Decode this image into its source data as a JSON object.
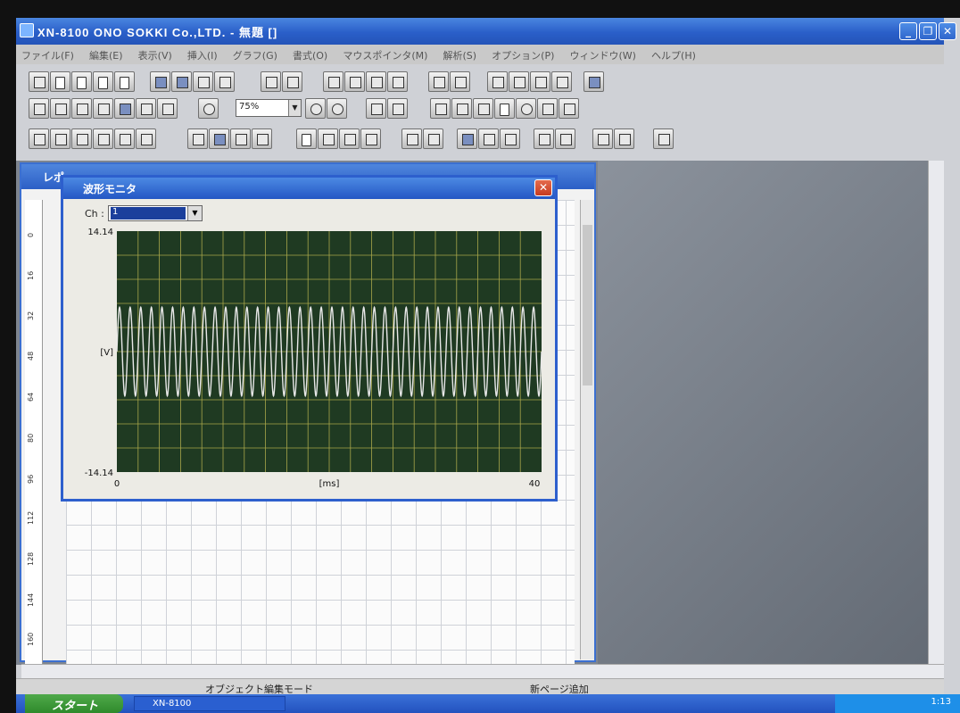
{
  "app": {
    "title": "XN-8100 ONO SOKKI Co.,LTD. - 無題 []"
  },
  "menu": [
    "ファイル(F)",
    "編集(E)",
    "表示(V)",
    "挿入(I)",
    "グラフ(G)",
    "書式(O)",
    "マウスポインタ(M)",
    "解析(S)",
    "オプション(P)",
    "ウィンドウ(W)",
    "ヘルプ(H)"
  ],
  "toolbar": {
    "zoom": "75%"
  },
  "document": {
    "title": "レポ"
  },
  "ruler": [
    "0",
    "16",
    "32",
    "48",
    "64",
    "80",
    "96",
    "112",
    "128",
    "144",
    "160"
  ],
  "wave_dialog": {
    "title": "波形モニタ",
    "ch_label": "Ch :",
    "ch_value": "1"
  },
  "chart_data": {
    "type": "line",
    "xlabel": "[ms]",
    "ylabel": "[V]",
    "xlim": [
      0,
      40
    ],
    "ylim": [
      -14.14,
      14.14
    ],
    "x_ticks": [
      "0",
      "40"
    ],
    "y_ticks": [
      "14.14",
      "-14.14"
    ],
    "grid": true,
    "background": "#1f3a22",
    "grid_color": "#a8a64a",
    "line_color": "#e8e8e8",
    "series": [
      {
        "waveform": "sine",
        "amplitude_v": 5.2,
        "cycles_in_window": 40,
        "offset_v": 0
      }
    ]
  },
  "status": {
    "mode": "オブジェクト編集モード",
    "right": "新ページ追加"
  },
  "taskbar": {
    "start": "スタート",
    "task": "XN-8100",
    "clock": "1:13"
  }
}
